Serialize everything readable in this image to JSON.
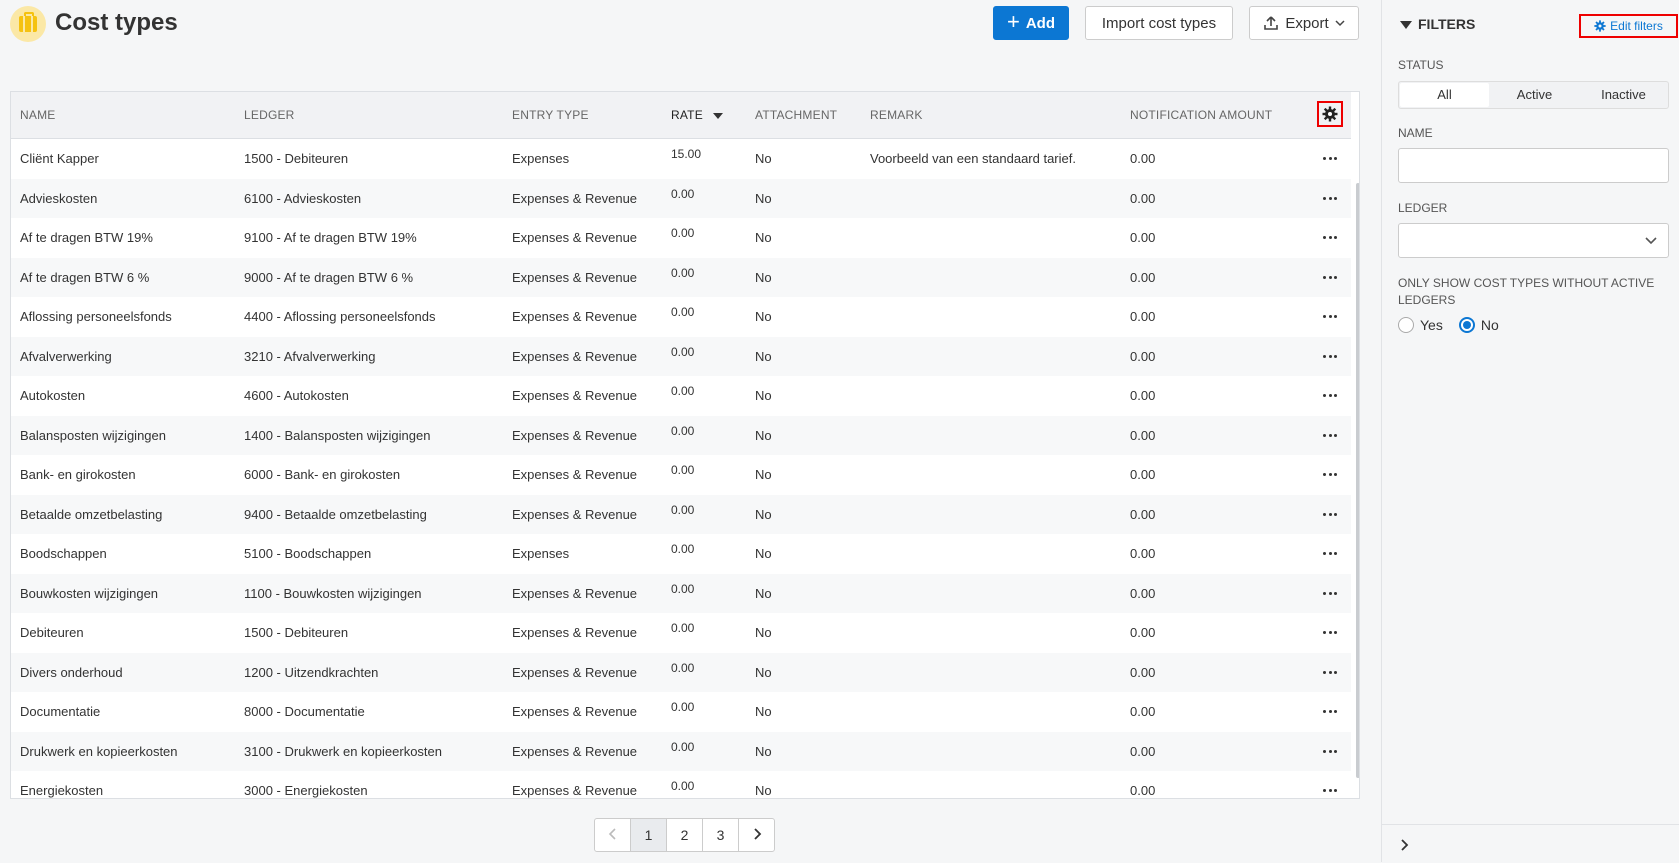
{
  "header": {
    "title": "Cost types",
    "add_label": "Add",
    "import_label": "Import cost types",
    "export_label": "Export"
  },
  "table": {
    "columns": [
      "NAME",
      "LEDGER",
      "ENTRY TYPE",
      "RATE",
      "ATTACHMENT",
      "REMARK",
      "NOTIFICATION AMOUNT"
    ],
    "sorted_column": "RATE",
    "sort_direction": "descending",
    "rows": [
      {
        "name": "Cliënt Kapper",
        "ledger": "1500 - Debiteuren",
        "entry_type": "Expenses",
        "rate": "15.00",
        "attachment": "No",
        "remark": "Voorbeeld van een standaard tarief.",
        "notification_amount": "0.00"
      },
      {
        "name": "Advieskosten",
        "ledger": "6100 - Advieskosten",
        "entry_type": "Expenses & Revenue",
        "rate": "0.00",
        "attachment": "No",
        "remark": "",
        "notification_amount": "0.00"
      },
      {
        "name": "Af te dragen BTW 19%",
        "ledger": "9100 - Af te dragen BTW 19%",
        "entry_type": "Expenses & Revenue",
        "rate": "0.00",
        "attachment": "No",
        "remark": "",
        "notification_amount": "0.00"
      },
      {
        "name": "Af te dragen BTW 6 %",
        "ledger": "9000 - Af te dragen BTW 6 %",
        "entry_type": "Expenses & Revenue",
        "rate": "0.00",
        "attachment": "No",
        "remark": "",
        "notification_amount": "0.00"
      },
      {
        "name": "Aflossing personeelsfonds",
        "ledger": "4400 - Aflossing personeelsfonds",
        "entry_type": "Expenses & Revenue",
        "rate": "0.00",
        "attachment": "No",
        "remark": "",
        "notification_amount": "0.00"
      },
      {
        "name": "Afvalverwerking",
        "ledger": "3210 - Afvalverwerking",
        "entry_type": "Expenses & Revenue",
        "rate": "0.00",
        "attachment": "No",
        "remark": "",
        "notification_amount": "0.00"
      },
      {
        "name": "Autokosten",
        "ledger": "4600 - Autokosten",
        "entry_type": "Expenses & Revenue",
        "rate": "0.00",
        "attachment": "No",
        "remark": "",
        "notification_amount": "0.00"
      },
      {
        "name": "Balansposten wijzigingen",
        "ledger": "1400 - Balansposten wijzigingen",
        "entry_type": "Expenses & Revenue",
        "rate": "0.00",
        "attachment": "No",
        "remark": "",
        "notification_amount": "0.00"
      },
      {
        "name": "Bank- en girokosten",
        "ledger": "6000 - Bank- en girokosten",
        "entry_type": "Expenses & Revenue",
        "rate": "0.00",
        "attachment": "No",
        "remark": "",
        "notification_amount": "0.00"
      },
      {
        "name": "Betaalde omzetbelasting",
        "ledger": "9400 - Betaalde omzetbelasting",
        "entry_type": "Expenses & Revenue",
        "rate": "0.00",
        "attachment": "No",
        "remark": "",
        "notification_amount": "0.00"
      },
      {
        "name": "Boodschappen",
        "ledger": "5100 - Boodschappen",
        "entry_type": "Expenses",
        "rate": "0.00",
        "attachment": "No",
        "remark": "",
        "notification_amount": "0.00"
      },
      {
        "name": "Bouwkosten wijzigingen",
        "ledger": "1100 - Bouwkosten wijzigingen",
        "entry_type": "Expenses & Revenue",
        "rate": "0.00",
        "attachment": "No",
        "remark": "",
        "notification_amount": "0.00"
      },
      {
        "name": "Debiteuren",
        "ledger": "1500 - Debiteuren",
        "entry_type": "Expenses & Revenue",
        "rate": "0.00",
        "attachment": "No",
        "remark": "",
        "notification_amount": "0.00"
      },
      {
        "name": "Divers onderhoud",
        "ledger": "1200 - Uitzendkrachten",
        "entry_type": "Expenses & Revenue",
        "rate": "0.00",
        "attachment": "No",
        "remark": "",
        "notification_amount": "0.00"
      },
      {
        "name": "Documentatie",
        "ledger": "8000 - Documentatie",
        "entry_type": "Expenses & Revenue",
        "rate": "0.00",
        "attachment": "No",
        "remark": "",
        "notification_amount": "0.00"
      },
      {
        "name": "Drukwerk en kopieerkosten",
        "ledger": "3100 - Drukwerk en kopieerkosten",
        "entry_type": "Expenses & Revenue",
        "rate": "0.00",
        "attachment": "No",
        "remark": "",
        "notification_amount": "0.00"
      },
      {
        "name": "Energiekosten",
        "ledger": "3000 - Energiekosten",
        "entry_type": "Expenses & Revenue",
        "rate": "0.00",
        "attachment": "No",
        "remark": "",
        "notification_amount": "0.00"
      }
    ]
  },
  "pagination": {
    "pages": [
      "1",
      "2",
      "3"
    ],
    "current": "1"
  },
  "filters": {
    "title": "FILTERS",
    "edit_label": "Edit filters",
    "status_label": "STATUS",
    "status_options": [
      "All",
      "Active",
      "Inactive"
    ],
    "status_selected": "All",
    "name_label": "NAME",
    "name_value": "",
    "ledger_label": "LEDGER",
    "ledger_value": "",
    "inactive_label": "ONLY SHOW COST TYPES WITHOUT ACTIVE LEDGERS",
    "inactive_options": [
      "Yes",
      "No"
    ],
    "inactive_selected": "No"
  },
  "colors": {
    "primary": "#0c77d3",
    "highlight_border": "#e00000",
    "app_icon": "#f5c211"
  }
}
